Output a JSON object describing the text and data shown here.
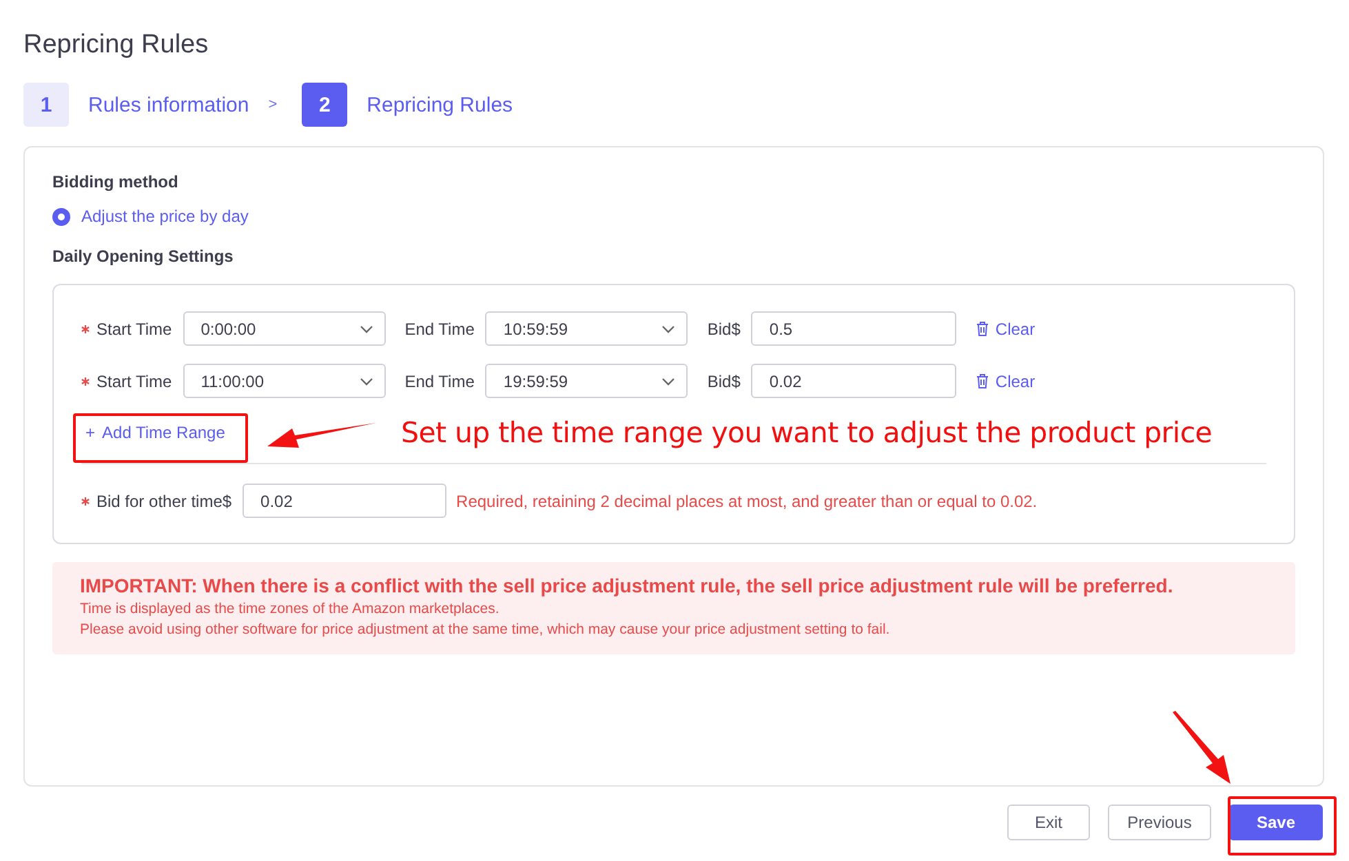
{
  "page": {
    "title": "Repricing Rules"
  },
  "steps": [
    {
      "number": "1",
      "label": "Rules information",
      "selected": false
    },
    {
      "number": "2",
      "label": "Repricing Rules",
      "selected": true
    }
  ],
  "step_separator": ">",
  "bidding_method": {
    "label": "Bidding method",
    "options": [
      {
        "label": "Adjust the price by day",
        "selected": true
      }
    ]
  },
  "daily_settings": {
    "label": "Daily Opening Settings",
    "ranges": [
      {
        "start_label": "Start Time",
        "start": "0:00:00",
        "end_label": "End Time",
        "end": "10:59:59",
        "bid_label": "Bid$",
        "bid": "0.5",
        "clear": "Clear"
      },
      {
        "start_label": "Start Time",
        "start": "11:00:00",
        "end_label": "End Time",
        "end": "19:59:59",
        "bid_label": "Bid$",
        "bid": "0.02",
        "clear": "Clear"
      }
    ],
    "add_range": {
      "icon": "+",
      "label": "Add Time Range"
    },
    "other_bid": {
      "label": "Bid for other time$",
      "value": "0.02",
      "error": "Required, retaining 2 decimal places at most, and greater than or equal to 0.02."
    }
  },
  "notice": {
    "headline": "IMPORTANT: When there is a conflict with the sell price adjustment rule, the sell price adjustment rule will be preferred.",
    "lines": [
      "Time is displayed as the time zones of the Amazon marketplaces.",
      "Please avoid using other software for price adjustment at the same time, which may cause your price adjustment setting to fail."
    ]
  },
  "buttons": [
    {
      "label": "Exit",
      "kind": "secondary"
    },
    {
      "label": "Previous",
      "kind": "secondary"
    },
    {
      "label": "Save",
      "kind": "primary"
    }
  ],
  "annotations": [
    {
      "kind": "note",
      "text": "Set up the time range you want to adjust the product price"
    }
  ]
}
